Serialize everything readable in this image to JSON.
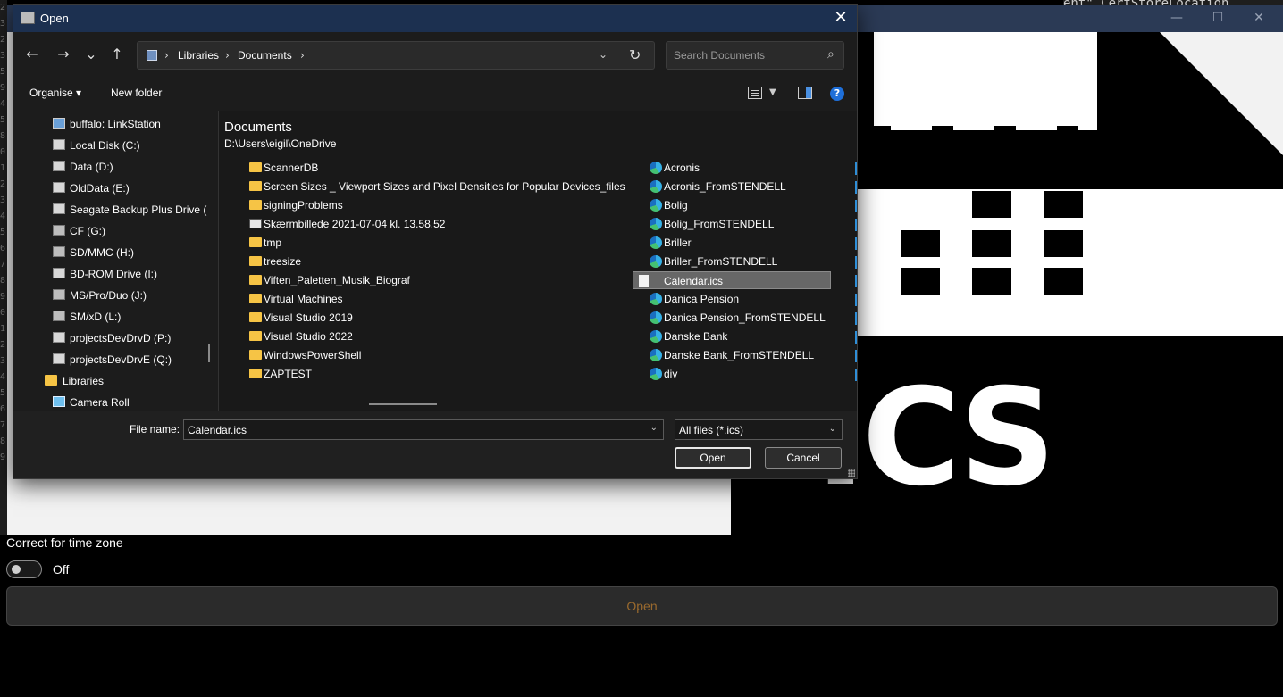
{
  "background_app": {
    "code_line_digits": [
      "2",
      "3",
      "2",
      "3",
      "5",
      "9",
      "4",
      "5",
      "8",
      "0",
      "1",
      "2",
      "3",
      "4",
      "5",
      "6",
      "7",
      "8",
      "9",
      "0",
      "1",
      "2",
      "3",
      "4",
      "5",
      "6",
      "7",
      "8",
      "9"
    ],
    "top_code_snippet": "ent\" CertStoreLocation",
    "ics_letters": "ICS",
    "time_zone_label": "Correct for time zone",
    "time_zone_state": "Off",
    "open_button_label": "Open"
  },
  "dialog": {
    "title": "Open",
    "close_glyph": "✕",
    "nav": {
      "back": "←",
      "forward": "→",
      "recent": "⌄",
      "up": "↑"
    },
    "address": {
      "crumbs": [
        "Libraries",
        "Documents"
      ],
      "separator": "›",
      "dropdown": "⌄",
      "refresh": "↻"
    },
    "search": {
      "placeholder": "Search Documents",
      "icon_glyph": "⌕"
    },
    "toolbar": {
      "organise_label": "Organise ▾",
      "new_folder_label": "New folder",
      "view_dd": "▼",
      "help": "?"
    },
    "nav_pane": {
      "items": [
        {
          "label": "buffalo: LinkStation",
          "icon": "network-drive-icon"
        },
        {
          "label": "Local Disk (C:)",
          "icon": "local-disk-icon"
        },
        {
          "label": "Data (D:)",
          "icon": "drive-icon"
        },
        {
          "label": "OldData (E:)",
          "icon": "drive-icon"
        },
        {
          "label": "Seagate Backup Plus Drive (",
          "icon": "drive-icon"
        },
        {
          "label": "CF (G:)",
          "icon": "card-drive-icon"
        },
        {
          "label": "SD/MMC (H:)",
          "icon": "card-drive-icon"
        },
        {
          "label": "BD-ROM Drive (I:)",
          "icon": "optical-drive-icon"
        },
        {
          "label": "MS/Pro/Duo (J:)",
          "icon": "card-drive-icon"
        },
        {
          "label": "SM/xD (L:)",
          "icon": "card-drive-icon"
        },
        {
          "label": "projectsDevDrvD (P:)",
          "icon": "drive-icon"
        },
        {
          "label": "projectsDevDrvE (Q:)",
          "icon": "drive-icon"
        },
        {
          "label": "Libraries",
          "icon": "folder-icon"
        },
        {
          "label": "Camera Roll",
          "icon": "camera-roll-icon"
        }
      ]
    },
    "content": {
      "location_name": "Documents",
      "location_path": "D:\\Users\\eigil\\OneDrive",
      "column1": [
        {
          "name": "ScannerDB",
          "type": "folder"
        },
        {
          "name": "Screen Sizes _ Viewport Sizes and Pixel Densities for Popular Devices_files",
          "type": "folder"
        },
        {
          "name": "signingProblems",
          "type": "folder"
        },
        {
          "name": "Skærmbillede 2021-07-04 kl. 13.58.52",
          "type": "image"
        },
        {
          "name": "tmp",
          "type": "folder"
        },
        {
          "name": "treesize",
          "type": "folder"
        },
        {
          "name": "Viften_Paletten_Musik_Biograf",
          "type": "folder"
        },
        {
          "name": "Virtual Machines",
          "type": "folder"
        },
        {
          "name": "Visual Studio 2019",
          "type": "folder"
        },
        {
          "name": "Visual Studio 2022",
          "type": "folder"
        },
        {
          "name": "WindowsPowerShell",
          "type": "folder"
        },
        {
          "name": "ZAPTEST",
          "type": "folder"
        }
      ],
      "column2": [
        {
          "name": "Acronis",
          "type": "shortcut"
        },
        {
          "name": "Acronis_FromSTENDELL",
          "type": "shortcut"
        },
        {
          "name": "Bolig",
          "type": "shortcut"
        },
        {
          "name": "Bolig_FromSTENDELL",
          "type": "shortcut"
        },
        {
          "name": "Briller",
          "type": "shortcut"
        },
        {
          "name": "Briller_FromSTENDELL",
          "type": "shortcut"
        },
        {
          "name": "Calendar.ics",
          "type": "document",
          "selected": true
        },
        {
          "name": "Danica Pension",
          "type": "shortcut"
        },
        {
          "name": "Danica Pension_FromSTENDELL",
          "type": "shortcut"
        },
        {
          "name": "Danske Bank",
          "type": "shortcut"
        },
        {
          "name": "Danske Bank_FromSTENDELL",
          "type": "shortcut"
        },
        {
          "name": "div",
          "type": "shortcut"
        }
      ]
    },
    "bottom": {
      "filename_label": "File name:",
      "filename_value": "Calendar.ics",
      "filetype_value": "All files (*.ics)",
      "dd_glyph": "⌄",
      "open_label": "Open",
      "cancel_label": "Cancel"
    }
  },
  "colors": {
    "dialog_title_bg": "#1c3050",
    "selection_bg": "#676767",
    "folder": "#f6c445",
    "help_blue": "#1e6fd9",
    "bg_open_text": "#9a6a2e"
  }
}
